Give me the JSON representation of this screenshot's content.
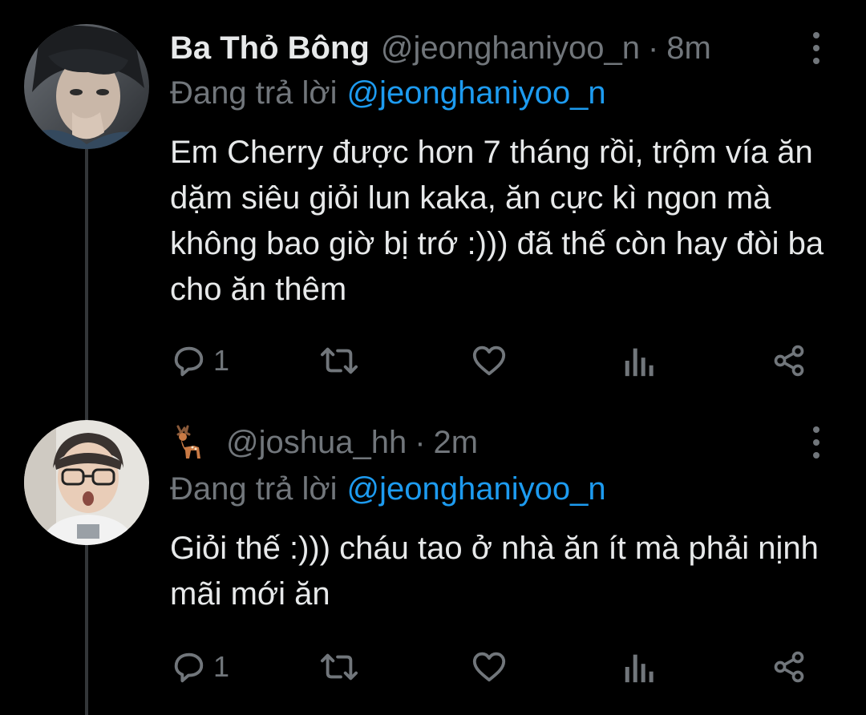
{
  "colors": {
    "background": "#000000",
    "text": "#e7e9ea",
    "muted": "#71767b",
    "link": "#1d9bf0",
    "thread_line": "#333639"
  },
  "tweets": [
    {
      "avatar": "avatar-photo",
      "display_name": "Ba Thỏ Bông",
      "handle": "@jeonghaniyoo_n",
      "separator": "·",
      "time": "8m",
      "reply_prefix": "Đang trả lời",
      "reply_handle": "@jeonghaniyoo_n",
      "text": "Em Cherry được hơn 7 tháng rồi, trộm vía ăn dặm siêu giỏi lun kaka, ăn cực kì ngon mà không bao giờ bị trớ :))) đã thế còn hay đòi ba cho ăn thêm",
      "reply_count": "1"
    },
    {
      "avatar": "avatar-photo",
      "display_name_emoji": "deer-icon",
      "handle": "@joshua_hh",
      "separator": "·",
      "time": "2m",
      "reply_prefix": "Đang trả lời",
      "reply_handle": "@jeonghaniyoo_n",
      "text": "Giỏi thế :))) cháu tao ở nhà ăn ít mà phải nịnh mãi mới ăn",
      "reply_count": "1"
    }
  ],
  "icons": {
    "reply": "reply-icon",
    "retweet": "retweet-icon",
    "like": "heart-icon",
    "views": "analytics-icon",
    "share": "share-icon",
    "more": "more-icon"
  }
}
